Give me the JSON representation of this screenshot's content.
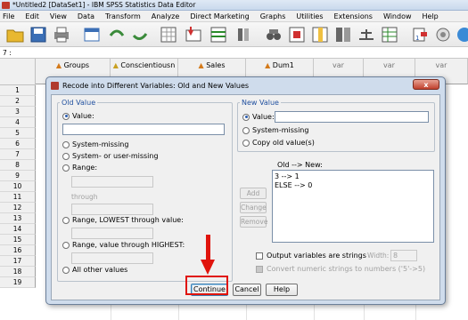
{
  "window": {
    "title": "*Untitled2 [DataSet1] - IBM SPSS Statistics Data Editor"
  },
  "menubar": [
    "File",
    "Edit",
    "View",
    "Data",
    "Transform",
    "Analyze",
    "Direct Marketing",
    "Graphs",
    "Utilities",
    "Extensions",
    "Window",
    "Help"
  ],
  "cell_ref": "7 :",
  "columns": [
    {
      "name": "Groups",
      "icon": "nominal-variable-icon"
    },
    {
      "name": "Conscientiousn",
      "icon": "scale-variable-icon"
    },
    {
      "name": "Sales",
      "icon": "nominal-variable-icon"
    },
    {
      "name": "Dum1",
      "icon": "nominal-variable-icon"
    },
    {
      "name": "var"
    },
    {
      "name": "var"
    },
    {
      "name": "var"
    }
  ],
  "rows": [
    "1",
    "2",
    "3",
    "4",
    "5",
    "6",
    "7",
    "8",
    "9",
    "10",
    "11",
    "12",
    "13",
    "14",
    "15",
    "16",
    "17",
    "18",
    "19"
  ],
  "dialog": {
    "title": "Recode into Different Variables: Old and New Values",
    "close": "x",
    "old_value": {
      "legend": "Old Value",
      "value_label": "Value:",
      "value_input": "",
      "system_missing": "System-missing",
      "system_or_user_missing": "System- or user-missing",
      "range": "Range:",
      "through": "through",
      "range_lowest": "Range, LOWEST through value:",
      "range_highest": "Range, value through HIGHEST:",
      "all_other": "All other values"
    },
    "new_value": {
      "legend": "New Value",
      "value_label": "Value:",
      "value_input": "",
      "system_missing": "System-missing",
      "copy_old": "Copy old value(s)"
    },
    "old_new": {
      "header": "Old --> New:",
      "items": [
        "3 --> 1",
        "ELSE --> 0"
      ]
    },
    "list_buttons": {
      "add": "Add",
      "change": "Change",
      "remove": "Remove"
    },
    "output_strings": {
      "label": "Output variables are strings",
      "width_label": "Width:",
      "width_value": "8"
    },
    "convert_numeric": "Convert numeric strings to numbers ('5'->5)",
    "buttons": {
      "continue": "Continue",
      "cancel": "Cancel",
      "help": "Help"
    }
  },
  "colors": {
    "highlight": "#e0140c",
    "dialog_frame": "#cfdcec",
    "legend_text": "#1f4f9e"
  }
}
